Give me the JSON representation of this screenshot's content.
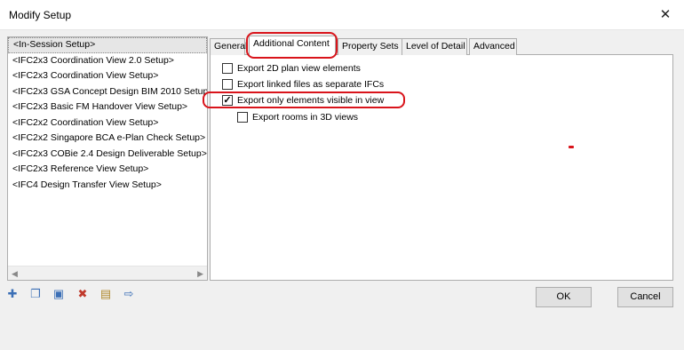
{
  "window": {
    "title": "Modify Setup",
    "close_glyph": "✕"
  },
  "setups": [
    "<In-Session Setup>",
    "<IFC2x3 Coordination View 2.0 Setup>",
    "<IFC2x3 Coordination View Setup>",
    "<IFC2x3 GSA Concept Design BIM 2010 Setup>",
    "<IFC2x3 Basic FM Handover View Setup>",
    "<IFC2x2 Coordination View Setup>",
    "<IFC2x2 Singapore BCA e-Plan Check Setup>",
    "<IFC2x3 COBie 2.4 Design Deliverable Setup>",
    "<IFC2x3 Reference View Setup>",
    "<IFC4 Design Transfer View Setup>"
  ],
  "selected_setup_index": 0,
  "tabs": [
    "General",
    "Additional Content",
    "Property Sets",
    "Level of Detail",
    "Advanced"
  ],
  "active_tab_index": 1,
  "options": [
    {
      "label": "Export 2D plan view elements",
      "checked": false
    },
    {
      "label": "Export linked files as separate IFCs",
      "checked": false
    },
    {
      "label": "Export only elements visible in view",
      "checked": true
    },
    {
      "label": "Export rooms in 3D views",
      "checked": false
    }
  ],
  "toolbar_icons": [
    "new-setup-icon",
    "duplicate-setup-icon",
    "rename-setup-icon",
    "delete-setup-icon",
    "import-setup-icon",
    "export-setup-icon"
  ],
  "buttons": {
    "ok": "OK",
    "cancel": "Cancel"
  },
  "annotation_color": "#d9141b"
}
